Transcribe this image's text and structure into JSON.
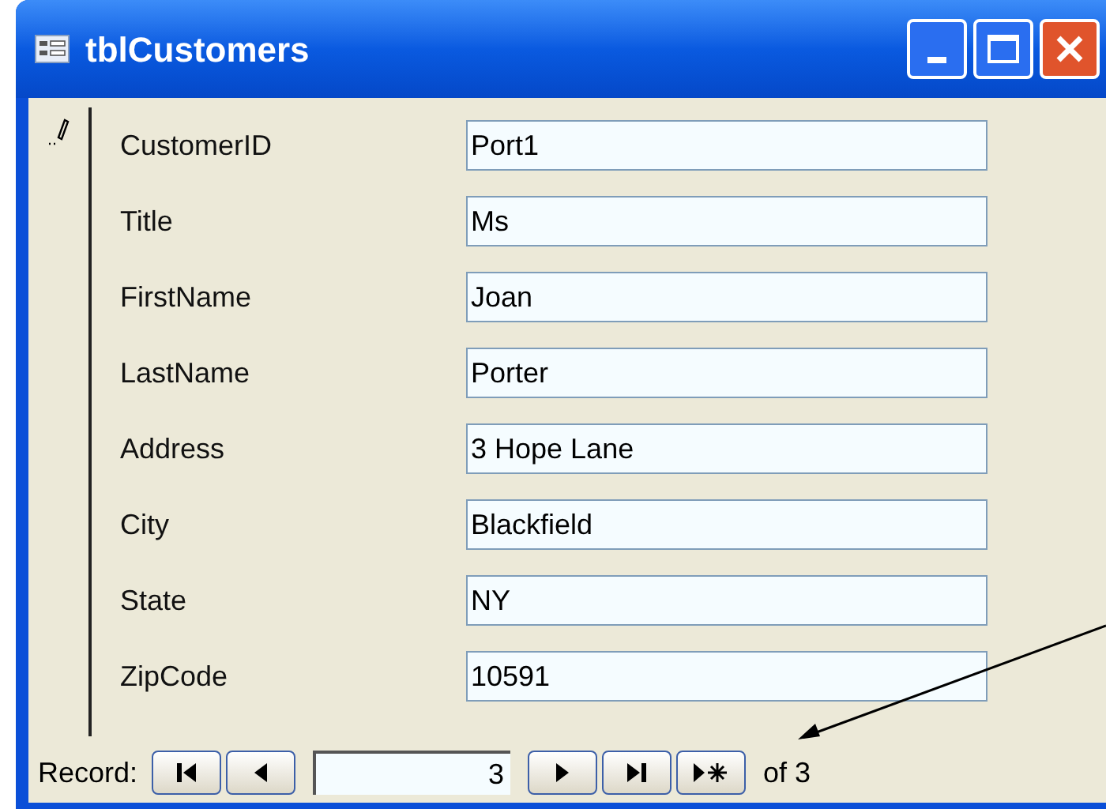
{
  "window": {
    "title": "tblCustomers"
  },
  "fields": [
    {
      "label": "CustomerID",
      "value": "Port1"
    },
    {
      "label": "Title",
      "value": "Ms"
    },
    {
      "label": "FirstName",
      "value": "Joan"
    },
    {
      "label": "LastName",
      "value": "Porter"
    },
    {
      "label": "Address",
      "value": "3 Hope Lane"
    },
    {
      "label": "City",
      "value": "Blackfield"
    },
    {
      "label": "State",
      "value": "NY"
    },
    {
      "label": "ZipCode",
      "value": "10591"
    }
  ],
  "navigation": {
    "label": "Record:",
    "current": "3",
    "total": "of 3"
  }
}
